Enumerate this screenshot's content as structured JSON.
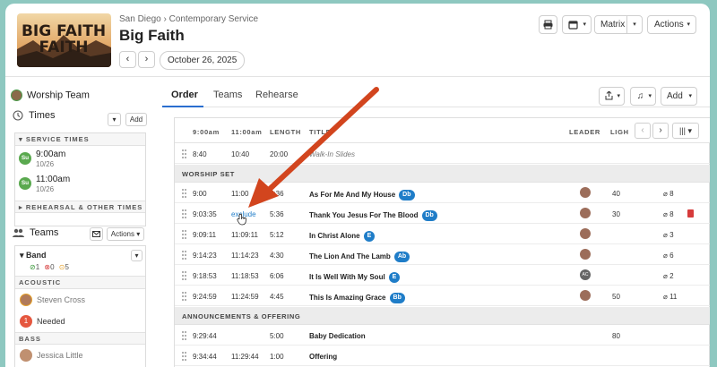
{
  "header": {
    "banner_text": "BIG FAITH",
    "breadcrumb": {
      "location": "San Diego",
      "separator": "›",
      "service_type": "Contemporary Service"
    },
    "title": "Big Faith",
    "date": "October 26, 2025",
    "buttons": {
      "print_icon": "printer-icon",
      "calendar_icon": "calendar-icon",
      "matrix": "Matrix",
      "actions": "Actions"
    }
  },
  "sidebar": {
    "team_name": "Worship Team",
    "times_label": "Times",
    "add_label": "Add",
    "service_times_header": "SERVICE TIMES",
    "service_times": [
      {
        "day": "Su",
        "time": "9:00am",
        "date": "10/26"
      },
      {
        "day": "Su",
        "time": "11:00am",
        "date": "10/26"
      }
    ],
    "rehearsal_header": "REHEARSAL & OTHER TIMES",
    "teams_label": "Teams",
    "teams_actions": "Actions",
    "band": {
      "name": "Band",
      "confirmed": "1",
      "declined": "0",
      "pending": "5"
    },
    "acoustic_header": "ACOUSTIC",
    "acoustic_person": "Steven Cross",
    "needed_count": "1",
    "needed_label": "Needed",
    "bass_header": "BASS",
    "bass_person": "Jessica Little"
  },
  "main": {
    "tabs": [
      "Order",
      "Teams",
      "Rehearse"
    ],
    "add_label": "Add",
    "columns": {
      "t1": "9:00am",
      "t2": "11:00am",
      "length": "LENGTH",
      "title": "TITLE",
      "leader": "LEADER",
      "lights": "LIGH"
    },
    "rows": [
      {
        "kind": "item",
        "t1": "8:40",
        "t2": "10:40",
        "len": "20:00",
        "title": "Walk-In Slides",
        "italic": true
      },
      {
        "kind": "header",
        "title": "WORSHIP SET"
      },
      {
        "kind": "song",
        "t1": "9:00",
        "t2": "11:00",
        "len": "5:36",
        "title": "As For Me And My House",
        "key": "Db",
        "avatar": true,
        "extra": "40",
        "att": "8"
      },
      {
        "kind": "song",
        "t1": "9:03:35",
        "t2": "exclude",
        "len": "5:36",
        "title": "Thank You Jesus For The Blood",
        "key": "Db",
        "avatar": true,
        "extra": "30",
        "att": "8",
        "trash": true
      },
      {
        "kind": "song",
        "t1": "9:09:11",
        "t2": "11:09:11",
        "len": "5:12",
        "title": "In Christ Alone",
        "key": "E",
        "avatar": true,
        "extra": "",
        "att": "3"
      },
      {
        "kind": "song",
        "t1": "9:14:23",
        "t2": "11:14:23",
        "len": "4:30",
        "title": "The Lion And The Lamb",
        "key": "Ab",
        "avatar": true,
        "extra": "",
        "att": "6"
      },
      {
        "kind": "song",
        "t1": "9:18:53",
        "t2": "11:18:53",
        "len": "6:06",
        "title": "It Is Well With My Soul",
        "key": "E",
        "avatar": true,
        "avatar_text": "AC",
        "extra": "",
        "att": "2"
      },
      {
        "kind": "song",
        "t1": "9:24:59",
        "t2": "11:24:59",
        "len": "4:45",
        "title": "This Is Amazing Grace",
        "key": "Bb",
        "avatar": true,
        "extra": "50",
        "att": "11"
      },
      {
        "kind": "header",
        "title": "ANNOUNCEMENTS & OFFERING"
      },
      {
        "kind": "item",
        "t1": "9:29:44",
        "t2": "",
        "len": "5:00",
        "title": "Baby Dedication",
        "extra": "80"
      },
      {
        "kind": "item",
        "t1": "9:34:44",
        "t2": "11:29:44",
        "len": "1:00",
        "title": "Offering"
      }
    ]
  },
  "colors": {
    "accent": "#1f7dc8",
    "arrow": "#d2451e",
    "success": "#3c9a3c",
    "danger": "#d63b3b",
    "warning": "#e5a12a"
  }
}
